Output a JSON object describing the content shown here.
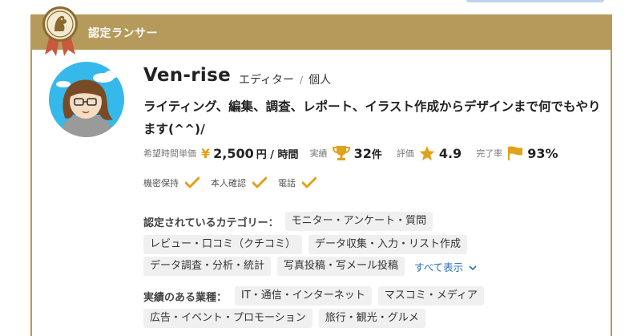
{
  "card": {
    "header_label": "認定ランサー"
  },
  "profile": {
    "name": "Ven-rise",
    "role": "エディター",
    "separator": "/",
    "type": "個人",
    "tagline": "ライティング、編集、調査、レポート、イラスト作成からデザインまで何でもやります(^^)/"
  },
  "stats": {
    "rate_label": "希望時間単価",
    "rate_currency": "¥",
    "rate_value": "2,500",
    "rate_unit": "円 / 時間",
    "jobs_label": "実績",
    "jobs_value": "32",
    "jobs_unit": "件",
    "rating_label": "評価",
    "rating_value": "4.9",
    "completion_label": "完了率",
    "completion_value": "93%"
  },
  "checks": [
    {
      "label": "機密保持"
    },
    {
      "label": "本人確認"
    },
    {
      "label": "電話"
    }
  ],
  "categories": {
    "label": "認定されているカテゴリー：",
    "items": [
      "モニター・アンケート・質問",
      "レビュー・口コミ（クチコミ）",
      "データ収集・入力・リスト作成",
      "データ調査・分析・統計",
      "写真投稿・写メール投稿"
    ],
    "show_all": "すべて表示"
  },
  "industries": {
    "label": "実績のある業種：",
    "items": [
      "IT・通信・インターネット",
      "マスコミ・メディア",
      "広告・イベント・プロモーション",
      "旅行・観光・グルメ"
    ]
  },
  "colors": {
    "accent_gold": "#b59a5b",
    "icon_gold": "#e0a21b",
    "link_blue": "#2a6ebb"
  },
  "icons": [
    "certified-badge-icon",
    "trophy-icon",
    "star-icon",
    "flag-icon",
    "check-icon",
    "chevron-down-icon"
  ]
}
